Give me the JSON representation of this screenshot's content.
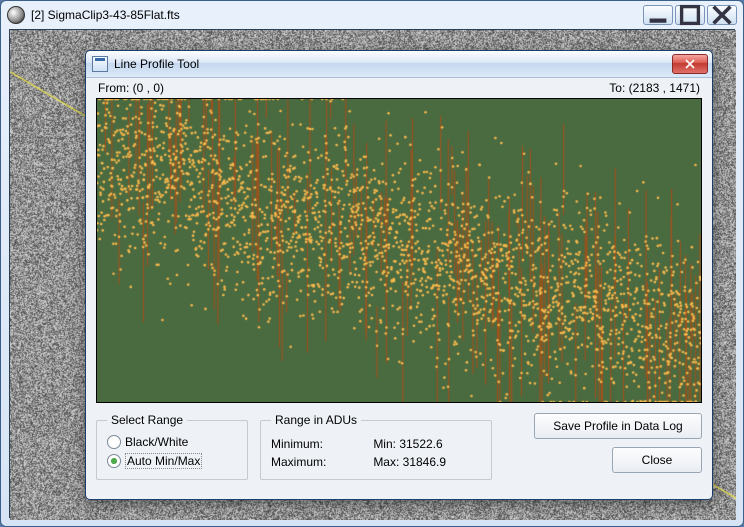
{
  "outerWindow": {
    "title": "[2] SigmaClip3-43-85Flat.fts"
  },
  "dialog": {
    "title": "Line Profile Tool",
    "fromLabel": "From: (0 , 0)",
    "toLabel": "To: (2183 , 1471)",
    "selectRange": {
      "legend": "Select Range",
      "blackWhite": "Black/White",
      "autoMinMax": "Auto Min/Max",
      "selected": "autoMinMax"
    },
    "rangeADU": {
      "legend": "Range in ADUs",
      "minLabel": "Minimum:",
      "minValue": "Min: 31522.6",
      "maxLabel": "Maximum:",
      "maxValue": "Max: 31846.9"
    },
    "buttons": {
      "save": "Save Profile in Data Log",
      "close": "Close"
    }
  },
  "chart_data": {
    "type": "scatter",
    "title": "",
    "xlabel": "",
    "ylabel": "",
    "xlim": [
      0,
      2630
    ],
    "ylim": [
      31522.6,
      31846.9
    ],
    "n_points": 2630,
    "trend": {
      "start": 31790,
      "end": 31590
    },
    "noise_sigma": 55,
    "spike_fraction": 0.06
  },
  "colors": {
    "plotBg": "#4a6a40",
    "spike": "#a85018",
    "pointFill": "#f7b94d",
    "pointStroke": "#7a3e10"
  }
}
